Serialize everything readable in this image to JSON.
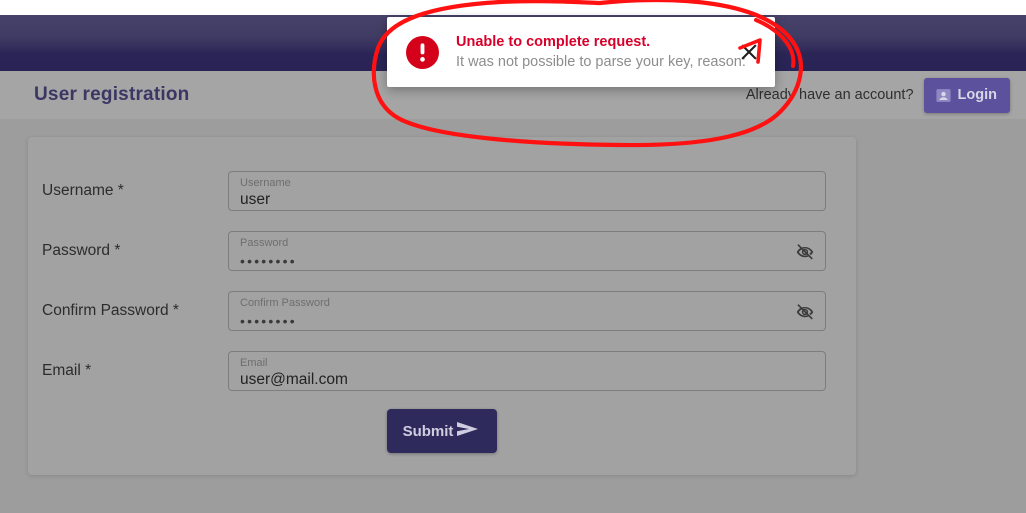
{
  "window": {
    "background_color": "#ffffff"
  },
  "toolbar": {
    "gradient_top": "#474269",
    "gradient_bottom": "#2a2456"
  },
  "header": {
    "title": "User registration",
    "have_account_text": "Already have an account?",
    "login_label": "Login",
    "login_icon": "account-box-icon",
    "login_bg": "#5b519c",
    "band_bg": "#a5a5a5"
  },
  "form": {
    "card_bg": "#a2a2a2",
    "fields": [
      {
        "label": "Username *",
        "placeholder": "Username",
        "value": "user",
        "type": "text",
        "name": "username"
      },
      {
        "label": "Password *",
        "placeholder": "Password",
        "value": "••••••••",
        "type": "password",
        "name": "password",
        "toggle_icon": "eye-off-icon"
      },
      {
        "label": "Confirm Password *",
        "placeholder": "Confirm Password",
        "value": "••••••••",
        "type": "password",
        "name": "confirm-password",
        "toggle_icon": "eye-off-icon"
      },
      {
        "label": "Email *",
        "placeholder": "Email",
        "value": "user@mail.com",
        "type": "email",
        "name": "email"
      }
    ],
    "submit_label": "Submit",
    "submit_icon": "send-arrow-icon",
    "submit_bg": "#2f2a5c"
  },
  "error_dialog": {
    "icon": "error-exclamation-icon",
    "icon_color": "#d50019",
    "title": "Unable to complete request.",
    "title_color": "#d8002a",
    "message": "It was not possible to parse your key, reason:",
    "close_icon": "close-icon"
  },
  "annotation": {
    "shape": "hand-drawn-ellipse",
    "color": "#ff1111",
    "stroke_width": 4
  }
}
